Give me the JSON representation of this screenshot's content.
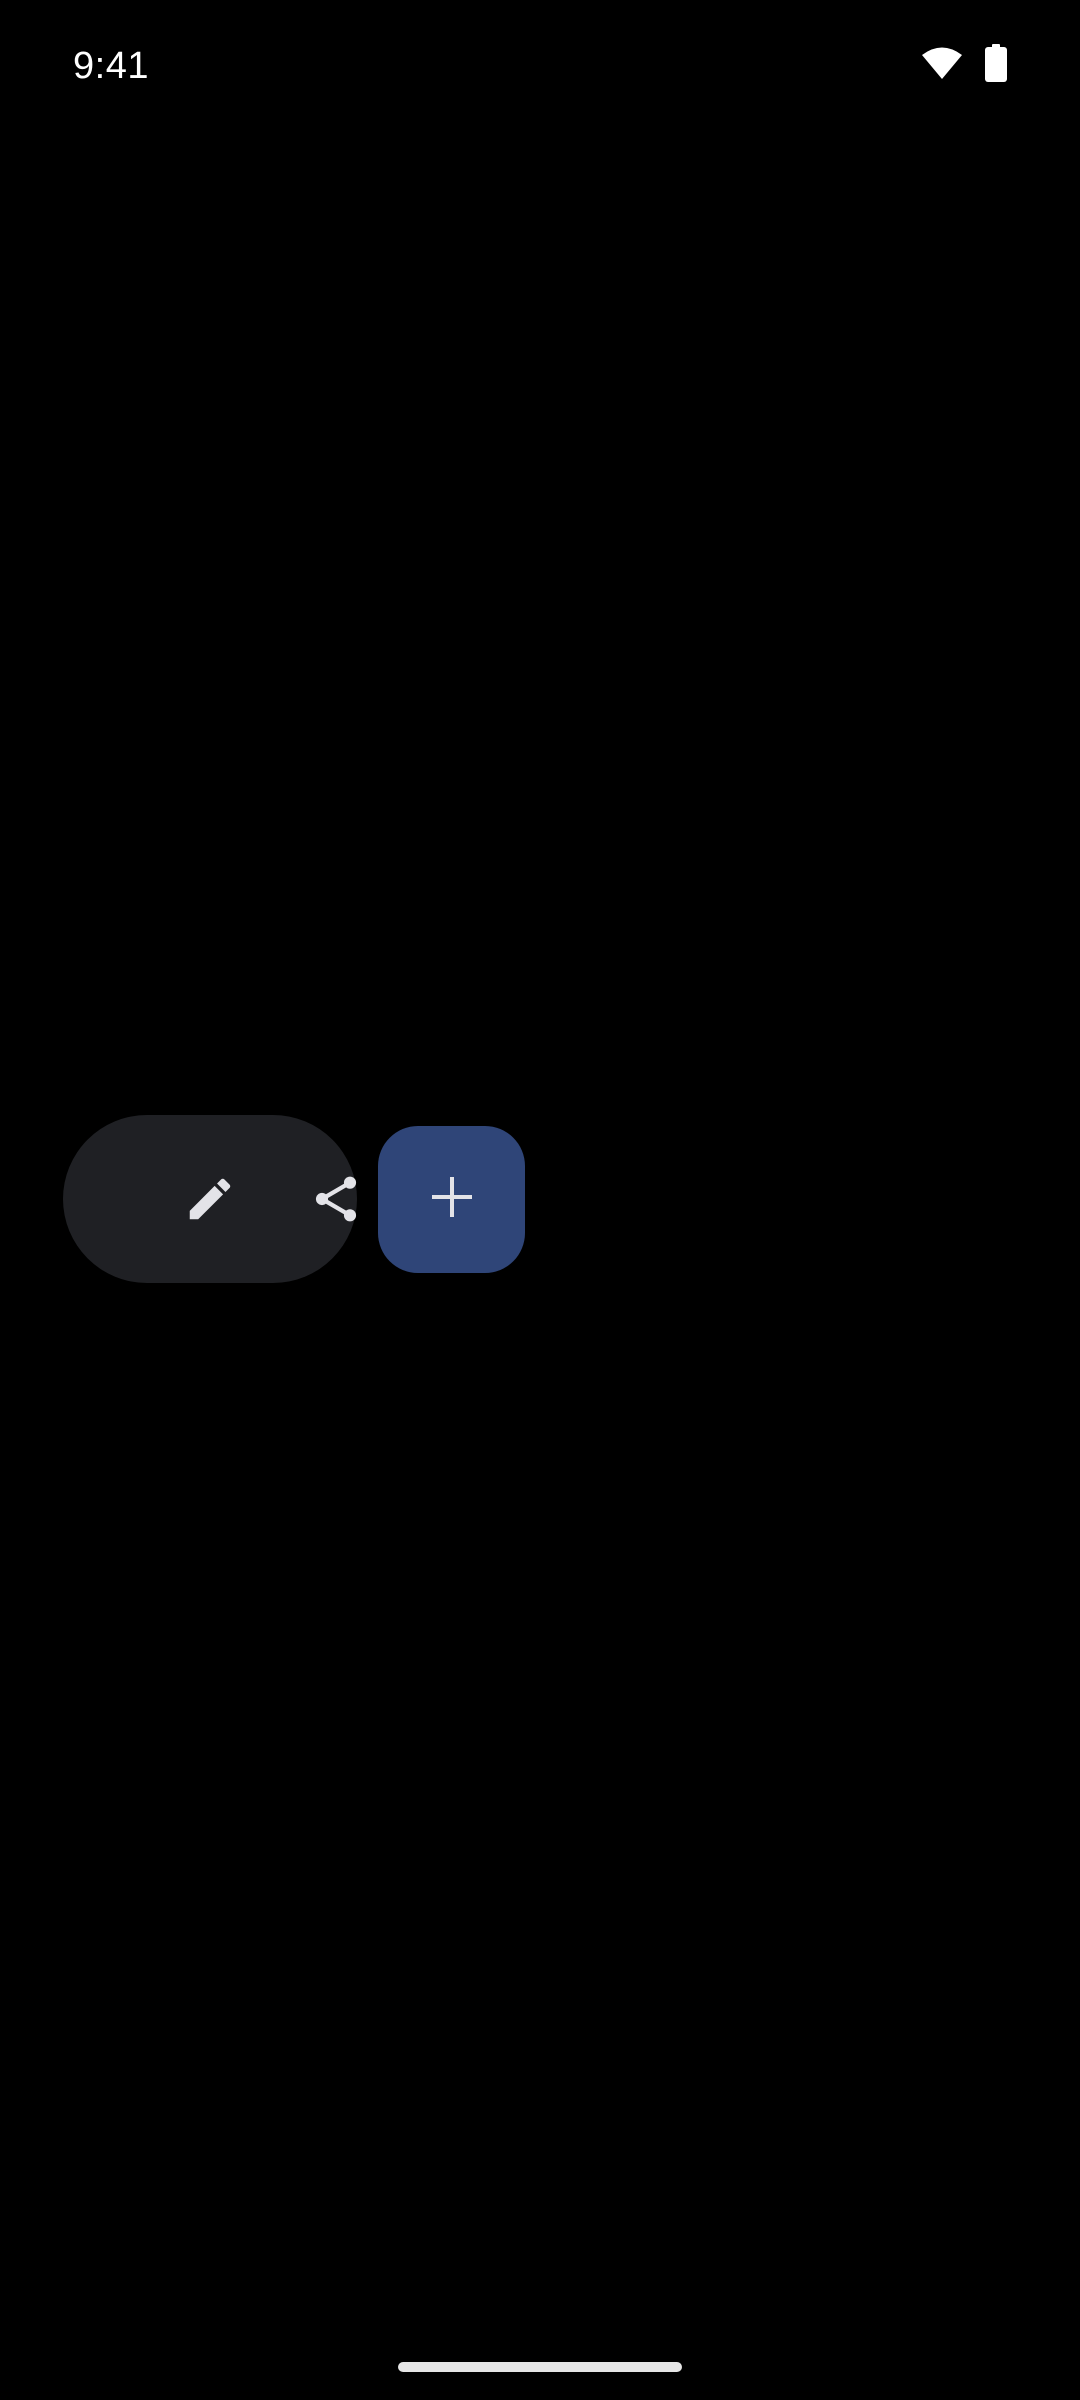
{
  "status_bar": {
    "time": "9:41",
    "icons": [
      "wifi-icon",
      "battery-icon"
    ]
  },
  "toolbar": {
    "buttons": [
      {
        "icon": "pencil-icon",
        "action": "edit"
      },
      {
        "icon": "share-icon",
        "action": "share"
      }
    ]
  },
  "fab": {
    "icon": "plus-icon"
  },
  "colors": {
    "background": "#000000",
    "toolbar_surface": "#1f2024",
    "fab_container": "#2f4578",
    "icon_tint": "#e3e3e8"
  }
}
